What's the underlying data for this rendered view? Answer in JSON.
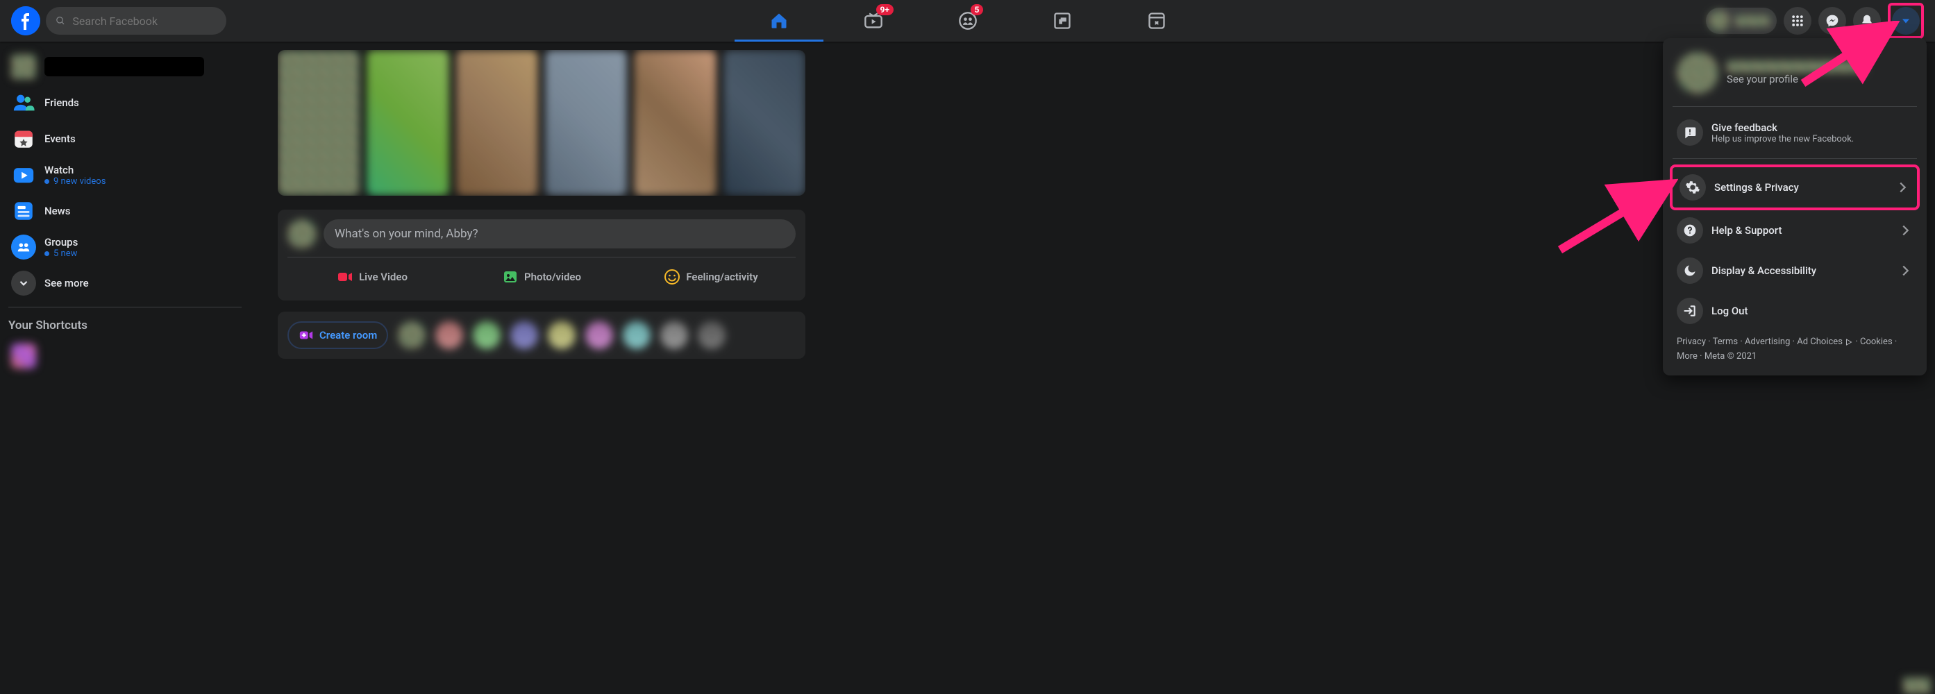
{
  "header": {
    "search_placeholder": "Search Facebook",
    "tabs": {
      "watch_badge": "9+",
      "groups_badge": "5"
    }
  },
  "sidebar": {
    "items": [
      {
        "label": "Friends"
      },
      {
        "label": "Events"
      },
      {
        "label": "Watch",
        "sub": "9 new videos"
      },
      {
        "label": "News"
      },
      {
        "label": "Groups",
        "sub": "5 new"
      }
    ],
    "see_more": "See more",
    "shortcuts_heading": "Your Shortcuts"
  },
  "composer": {
    "placeholder": "What's on your mind, Abby?",
    "live": "Live Video",
    "photo": "Photo/video",
    "feeling": "Feeling/activity"
  },
  "rooms": {
    "create": "Create room"
  },
  "dropdown": {
    "see_profile": "See your profile",
    "feedback_t": "Give feedback",
    "feedback_s": "Help us improve the new Facebook.",
    "settings": "Settings & Privacy",
    "help": "Help & Support",
    "display": "Display & Accessibility",
    "logout": "Log Out",
    "footer": {
      "privacy": "Privacy",
      "terms": "Terms",
      "advertising": "Advertising",
      "ad_choices": "Ad Choices",
      "cookies": "Cookies",
      "more": "More",
      "meta": "Meta © 2021"
    }
  }
}
